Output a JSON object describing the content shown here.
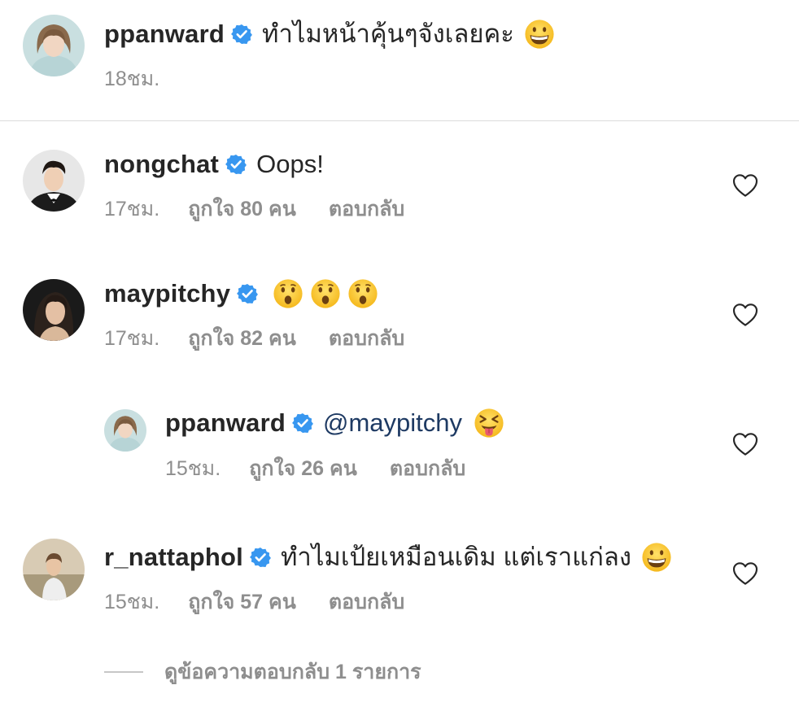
{
  "caption": {
    "username": "ppanward",
    "text": "ทำไมหน้าคุ้นๆจังเลยคะ",
    "time": "18ชม."
  },
  "comments": [
    {
      "username": "nongchat",
      "text": "Oops!",
      "time": "17ชม.",
      "likes": "ถูกใจ 80 คน",
      "reply": "ตอบกลับ"
    },
    {
      "username": "maypitchy",
      "text": "",
      "time": "17ชม.",
      "likes": "ถูกใจ 82 คน",
      "reply": "ตอบกลับ"
    },
    {
      "username": "ppanward",
      "text": "@maypitchy",
      "time": "15ชม.",
      "likes": "ถูกใจ 26 คน",
      "reply": "ตอบกลับ"
    },
    {
      "username": "r_nattaphol",
      "text": "ทำไมเป้ยเหมือนเดิม แต่เราแก่ลง",
      "time": "15ชม.",
      "likes": "ถูกใจ 57 คน",
      "reply": "ตอบกลับ"
    }
  ],
  "view_replies": "ดูข้อความตอบกลับ 1 รายการ",
  "icons": {
    "verified": "verified-badge-icon",
    "heart": "heart-outline-icon",
    "grin": "grinning-face-emoji",
    "surprised": "hushed-face-emoji",
    "tongue": "squinting-tongue-face-emoji"
  },
  "colors": {
    "text": "#262626",
    "secondary": "#8e8e8e",
    "verified": "#3897f0",
    "mention": "#1e3a63",
    "divider": "#dbdbdb"
  }
}
